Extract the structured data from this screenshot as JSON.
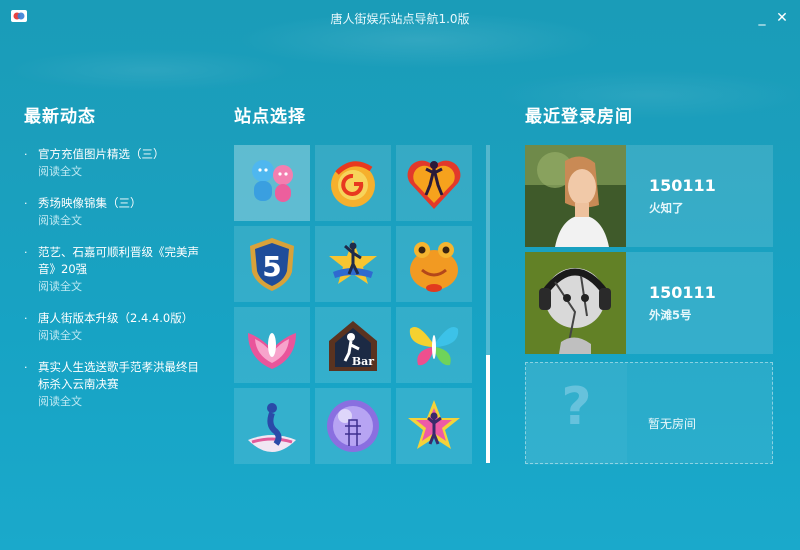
{
  "window": {
    "title": "唐人街娱乐站点导航1.0版",
    "minimize_glyph": "_",
    "close_glyph": "✕"
  },
  "news": {
    "title": "最新动态",
    "items": [
      {
        "headline": "官方充值图片精选（三）",
        "link": "阅读全文"
      },
      {
        "headline": "秀场映像锦集（三）",
        "link": "阅读全文"
      },
      {
        "headline": "范艺、石嘉可顺利晋级《完美声音》20强",
        "link": "阅读全文"
      },
      {
        "headline": "唐人街版本升级（2.4.4.0版）",
        "link": "阅读全文"
      },
      {
        "headline": "真实人生选送歌手范孝洪最终目标杀入云南决赛",
        "link": "阅读全文"
      }
    ]
  },
  "sites": {
    "title": "站点选择",
    "tiles": [
      {
        "icon": "couple-icon"
      },
      {
        "icon": "swirl-g-icon"
      },
      {
        "icon": "heart-dancer-icon"
      },
      {
        "icon": "shield-5-icon"
      },
      {
        "icon": "star-dancer-icon"
      },
      {
        "icon": "frog-icon"
      },
      {
        "icon": "pink-wings-icon"
      },
      {
        "icon": "bar-house-icon",
        "text": "Bar"
      },
      {
        "icon": "butterfly-icon"
      },
      {
        "icon": "mermaid-icon"
      },
      {
        "icon": "crystal-ball-icon"
      },
      {
        "icon": "star-singer-icon"
      }
    ],
    "scroll_position": 0.66
  },
  "recent_rooms": {
    "title": "最近登录房间",
    "rooms": [
      {
        "id": "150111",
        "name": "火知了"
      },
      {
        "id": "150111",
        "name": "外滩5号"
      }
    ],
    "empty_label": "暂无房间",
    "empty_glyph": "?"
  }
}
